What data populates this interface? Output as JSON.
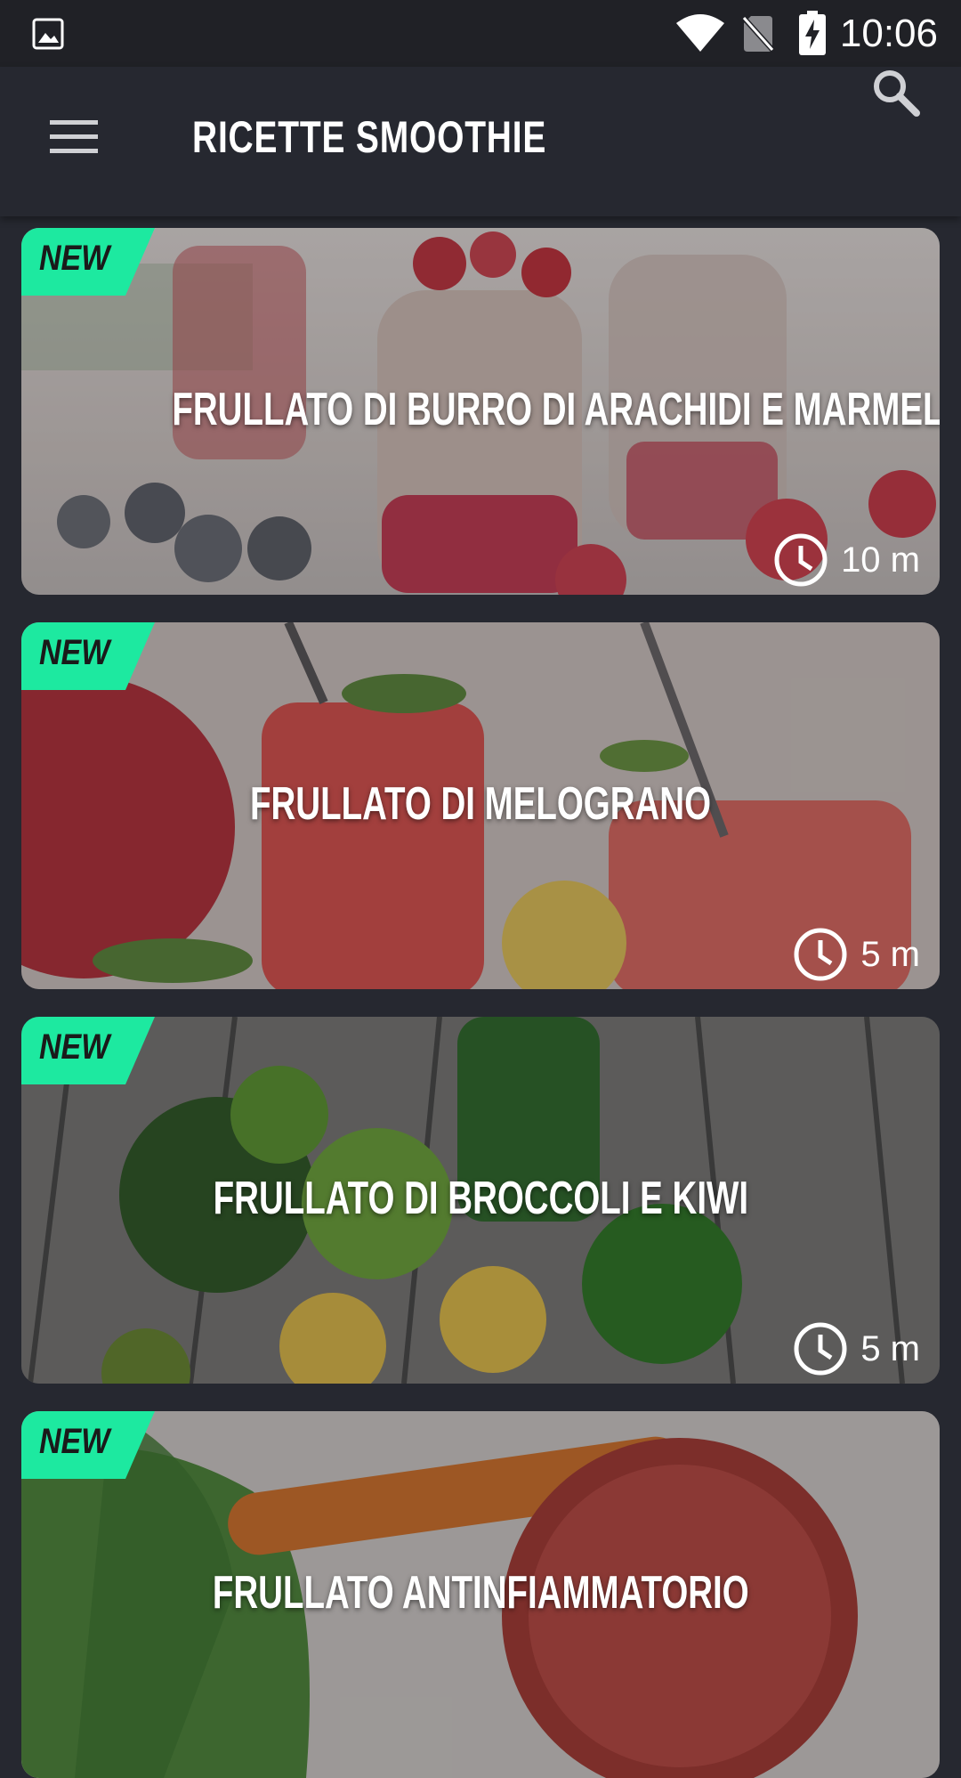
{
  "status_bar": {
    "time": "10:06",
    "icons": [
      "gallery-icon",
      "wifi-icon",
      "no-sim-icon",
      "battery-charging-icon"
    ]
  },
  "app_bar": {
    "title": "RICETTE SMOOTHIE",
    "menu_icon": "hamburger-menu-icon",
    "search_icon": "search-icon"
  },
  "colors": {
    "background": "#262830",
    "status_bar": "#202126",
    "badge": "#1de9a0",
    "text": "#ffffff"
  },
  "recipes": [
    {
      "badge": "NEW",
      "title": "FRULLATO DI BURRO DI ARACHIDI E MARMELLATA",
      "time": "10 m"
    },
    {
      "badge": "NEW",
      "title": "FRULLATO DI MELOGRANO",
      "time": "5 m"
    },
    {
      "badge": "NEW",
      "title": "FRULLATO DI BROCCOLI E KIWI",
      "time": "5 m"
    },
    {
      "badge": "NEW",
      "title": "FRULLATO ANTINFIAMMATORIO",
      "time": ""
    }
  ]
}
